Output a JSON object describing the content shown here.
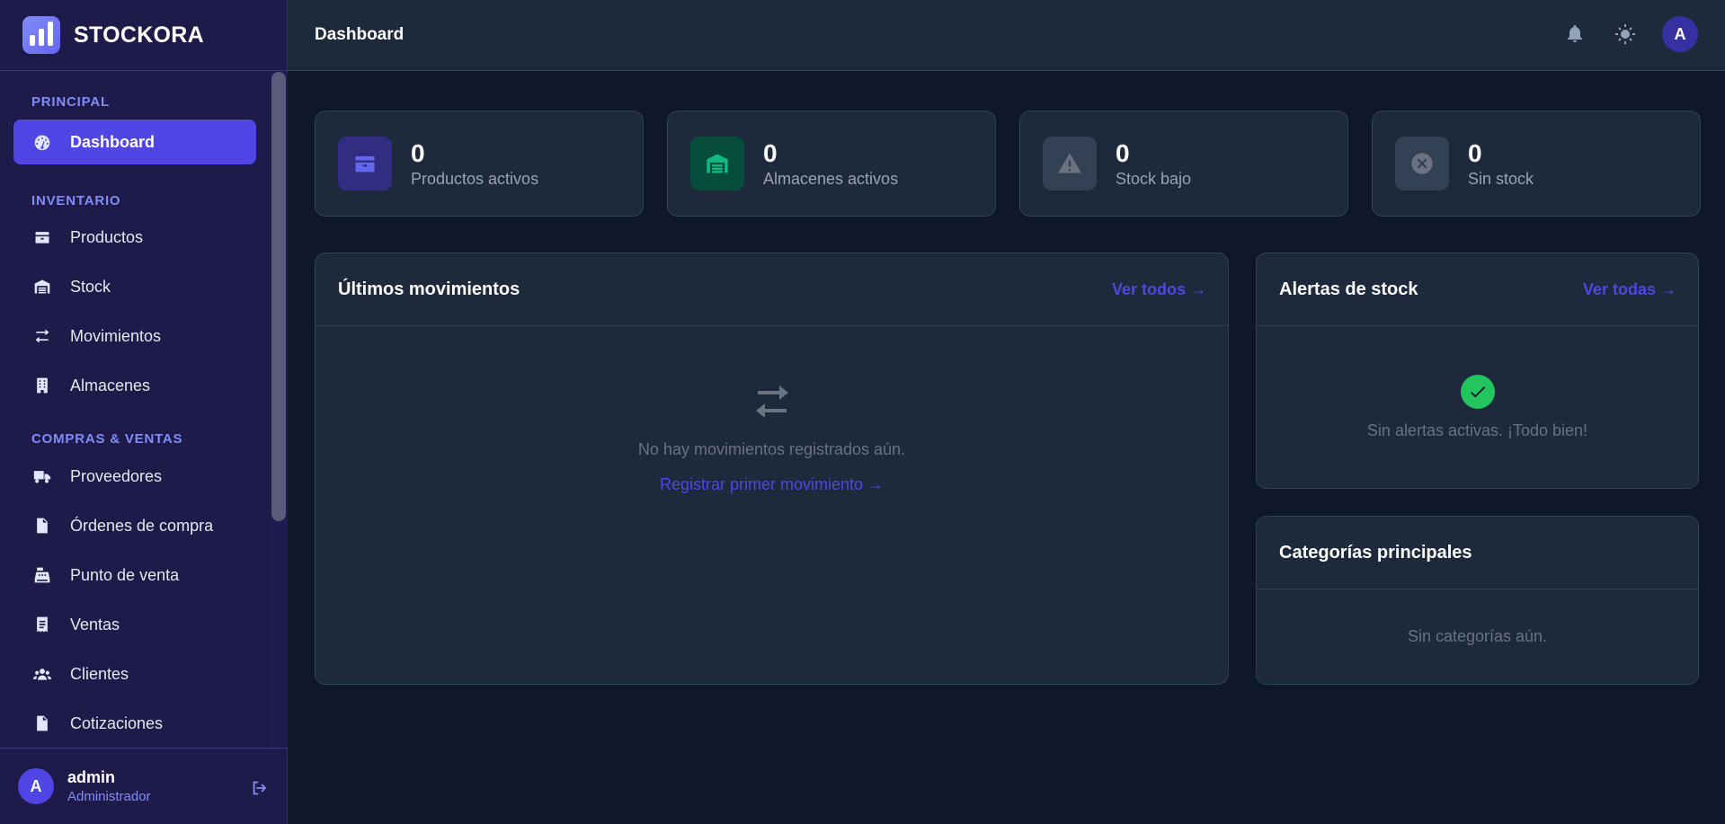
{
  "brand": {
    "name": "STOCKORA"
  },
  "sidebar": {
    "sections": [
      {
        "label": "PRINCIPAL"
      },
      {
        "label": "INVENTARIO"
      },
      {
        "label": "COMPRAS & VENTAS"
      }
    ],
    "items": [
      {
        "label": "Dashboard",
        "icon": "gauge-icon",
        "active": true
      },
      {
        "label": "Productos",
        "icon": "box-icon"
      },
      {
        "label": "Stock",
        "icon": "warehouse-icon"
      },
      {
        "label": "Movimientos",
        "icon": "arrows-exchange-icon"
      },
      {
        "label": "Almacenes",
        "icon": "building-icon"
      },
      {
        "label": "Proveedores",
        "icon": "truck-icon"
      },
      {
        "label": "Órdenes de compra",
        "icon": "file-invoice-icon"
      },
      {
        "label": "Punto de venta",
        "icon": "cash-register-icon"
      },
      {
        "label": "Ventas",
        "icon": "receipt-icon"
      },
      {
        "label": "Clientes",
        "icon": "users-icon"
      },
      {
        "label": "Cotizaciones",
        "icon": "file-lines-icon"
      }
    ],
    "user": {
      "initial": "A",
      "name": "admin",
      "role": "Administrador"
    }
  },
  "topbar": {
    "title": "Dashboard",
    "avatar_initial": "A"
  },
  "stats": [
    {
      "value": "0",
      "label": "Productos activos",
      "color": "#6366f1"
    },
    {
      "value": "0",
      "label": "Almacenes activos",
      "color": "#10b981"
    },
    {
      "value": "0",
      "label": "Stock bajo",
      "color": "#6b7280"
    },
    {
      "value": "0",
      "label": "Sin stock",
      "color": "#6b7280"
    }
  ],
  "movements": {
    "title": "Últimos movimientos",
    "link": "Ver todos →",
    "empty_text": "No hay movimientos registrados aún.",
    "empty_link": "Registrar primer movimiento →"
  },
  "alerts": {
    "title": "Alertas de stock",
    "link": "Ver todas →",
    "empty_text": "Sin alertas activas. ¡Todo bien!"
  },
  "categories": {
    "title": "Categorías principales",
    "empty_text": "Sin categorías aún."
  },
  "colors": {
    "accent": "#4f46e5",
    "sidebar_bg": "#1e1b4b",
    "page_bg": "#0f172a",
    "card_bg": "#1e293b",
    "success": "#22c55e"
  }
}
